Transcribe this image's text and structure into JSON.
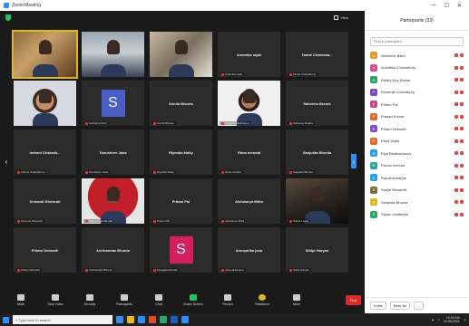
{
  "window": {
    "title": "Zoom Meeting"
  },
  "topbar": {
    "view_label": "View"
  },
  "tiles": [
    {
      "name": "",
      "label": "",
      "type": "video",
      "variant": "v-warm",
      "active": true
    },
    {
      "name": "",
      "label": "",
      "type": "video",
      "variant": "v-man"
    },
    {
      "name": "",
      "label": "",
      "type": "video",
      "variant": "v-room"
    },
    {
      "name": "Anamika rajak",
      "label": "Anamika rajak",
      "type": "name"
    },
    {
      "name": "Tamal Chakraba...",
      "label": "Tamal Chakraborty",
      "type": "name"
    },
    {
      "name": "",
      "label": "",
      "type": "video",
      "variant": "v-face"
    },
    {
      "name": "",
      "label": "Suchetna Paul",
      "type": "avatar",
      "letter": "S",
      "variant": "av-blue"
    },
    {
      "name": "Sonila Biswas",
      "label": "Sonila Biswas",
      "type": "name"
    },
    {
      "name": "",
      "label": "Swagata Mukherjee",
      "type": "video",
      "variant": "v-woman"
    },
    {
      "name": "Sabeeha Breara",
      "label": "Sabeeha Breara",
      "type": "name"
    },
    {
      "name": "Indrani Chakrab...",
      "label": "Indrani Chakraborty",
      "type": "name"
    },
    {
      "name": "Tanushree Jana",
      "label": "Tanushree Jana",
      "type": "name"
    },
    {
      "name": "Riyanka Maity",
      "label": "Riyanka Maity",
      "type": "name"
    },
    {
      "name": "Rima mondal",
      "label": "Rima mondal",
      "type": "name"
    },
    {
      "name": "Sanjukta Bhunia",
      "label": "Sanjukta Bhunia",
      "type": "name"
    },
    {
      "name": "Srimanti Dhewrah",
      "label": "Srimanti Dhewrah",
      "type": "name"
    },
    {
      "name": "",
      "label": "Sharmistha Mondal",
      "type": "video",
      "variant": "v-red"
    },
    {
      "name": "Pritam Pal",
      "label": "Pritam Pal",
      "type": "name"
    },
    {
      "name": "Aishwarya Mitra",
      "label": "Aishwarya Mitra",
      "type": "name"
    },
    {
      "name": "",
      "label": "Shilpa Layek",
      "type": "video",
      "variant": "v-dark"
    },
    {
      "name": "Pritam Debnath",
      "label": "Pritam Debnath",
      "type": "name"
    },
    {
      "name": "Anirbandas Bhunia",
      "label": "Anirbandas Bhunia",
      "type": "name"
    },
    {
      "name": "",
      "label": "Swagata Mondal",
      "type": "avatar",
      "letter": "S",
      "variant": "av-pink"
    },
    {
      "name": "Aranyatika jana",
      "label": "Aranyatika jana",
      "type": "name"
    },
    {
      "name": "Shilpi Haryan",
      "label": "Shilpi Haryan",
      "type": "name"
    }
  ],
  "toolbar": {
    "mute": "Mute",
    "stop_video": "Stop Video",
    "security": "Security",
    "participants": "Participants",
    "chat": "Chat",
    "share": "Share Screen",
    "record": "Record",
    "reactions": "Reactions",
    "more": "More",
    "end": "End"
  },
  "participants_panel": {
    "header": "Participants (33)",
    "search_placeholder": "Find a participant",
    "people": [
      {
        "name": "Abhishek Basu",
        "color": "#e09a2c",
        "initial": "A"
      },
      {
        "name": "Aninditha Chowdhury",
        "color": "#d94a8a",
        "initial": "A"
      },
      {
        "name": "Riddhi Dey Sarkar",
        "color": "#2ea36a",
        "initial": "R"
      },
      {
        "name": "Prosenjit Chowdhury",
        "color": "#7a4bc6",
        "initial": "P"
      },
      {
        "name": "Pritam Pal",
        "color": "#c64b8a",
        "initial": "P"
      },
      {
        "name": "Prasad Kumar",
        "color": "#e06a2c",
        "initial": "P"
      },
      {
        "name": "Pritam Debnath",
        "color": "#8a4bc6",
        "initial": "P"
      },
      {
        "name": "Rima Dutta",
        "color": "#e06a2c",
        "initial": "R"
      },
      {
        "name": "Riya Bhattacharya",
        "color": "#2c9ee0",
        "initial": "R"
      },
      {
        "name": "Rumia mondal",
        "color": "#2ea3a3",
        "initial": "R"
      },
      {
        "name": "Rupali Acharjee",
        "color": "#2c9ee0",
        "initial": "R"
      },
      {
        "name": "Sanjib Bhowmik",
        "color": "#7a6a4a",
        "initial": "S"
      },
      {
        "name": "Sanjukta Bhunia",
        "color": "#e0b81b",
        "initial": "S"
      },
      {
        "name": "Sayan chatterjee",
        "color": "#2ea36a",
        "initial": "S"
      }
    ],
    "invite": "Invite",
    "mute_all": "Mute All",
    "more": "..."
  },
  "taskbar": {
    "search_placeholder": "Type here to search",
    "time": "10:02 AM",
    "date": "04-08-2021"
  }
}
